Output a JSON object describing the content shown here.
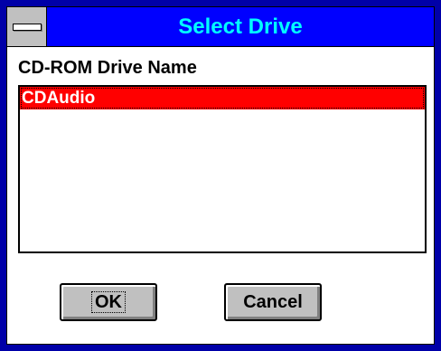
{
  "window": {
    "title": "Select Drive",
    "colors": {
      "title_bar": "#0000ff",
      "title_text": "#00ffff",
      "frame": "#0000a8",
      "selection": "#ff0000",
      "button_face": "#c0c0c0"
    }
  },
  "form": {
    "label": "CD-ROM Drive Name",
    "list_items": [
      {
        "label": "CDAudio",
        "selected": true
      }
    ]
  },
  "buttons": {
    "ok_label": "OK",
    "cancel_label": "Cancel"
  },
  "icons": {
    "system_menu": "system-menu-icon"
  }
}
